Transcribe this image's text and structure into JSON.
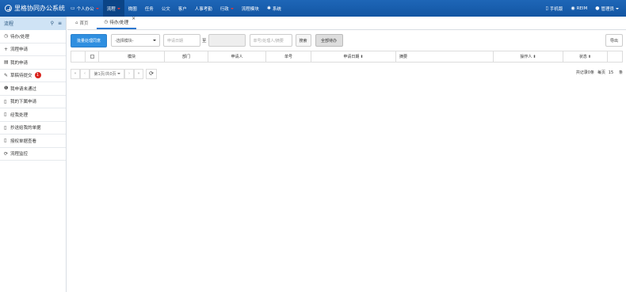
{
  "header": {
    "title": "里格协同办公系统",
    "nav": [
      {
        "label": "个人办公",
        "icon": "monitor-icon",
        "caret": true
      },
      {
        "label": "流程",
        "caret": true,
        "active": true
      },
      {
        "label": "微圈"
      },
      {
        "label": "任务"
      },
      {
        "label": "公文"
      },
      {
        "label": "客户"
      },
      {
        "label": "人事考勤"
      },
      {
        "label": "行政",
        "caret": true
      },
      {
        "label": "流程模块"
      },
      {
        "label": "系统",
        "icon": "gear-icon"
      }
    ],
    "right": [
      {
        "label": "手机版",
        "icon": "mobile-icon"
      },
      {
        "label": "REIM",
        "icon": "chat-icon"
      },
      {
        "label": "管理员",
        "icon": "user-icon",
        "caret": true
      }
    ]
  },
  "sidebar": {
    "title": "流程",
    "items": [
      {
        "label": "待办/处理",
        "icon": "clock-icon",
        "glyph": "◷"
      },
      {
        "label": "流程申请",
        "icon": "plus-icon",
        "glyph": "+"
      },
      {
        "label": "我的申请",
        "icon": "list-icon",
        "glyph": "▤"
      },
      {
        "label": "草稿待提交",
        "icon": "edit-icon",
        "glyph": "✎",
        "badge": "1"
      },
      {
        "label": "我申请未通过",
        "icon": "info-icon",
        "glyph": "❶"
      },
      {
        "label": "我的下属申请",
        "icon": "bookmark-icon",
        "glyph": "▯"
      },
      {
        "label": "经我处理",
        "icon": "bookmark-icon",
        "glyph": "▯"
      },
      {
        "label": "抄送给我的单据",
        "icon": "bookmark-icon",
        "glyph": "▯"
      },
      {
        "label": "授权单据查看",
        "icon": "bookmark-icon",
        "glyph": "▯"
      },
      {
        "label": "流程监控",
        "icon": "refresh-icon",
        "glyph": "⟳"
      }
    ]
  },
  "tabs": [
    {
      "label": "首页",
      "icon": "home-icon",
      "glyph": "⌂"
    },
    {
      "label": "待办/处理",
      "icon": "clock-icon",
      "glyph": "◷",
      "active": true
    }
  ],
  "toolbar": {
    "batch_label": "批量处理同意",
    "module_select": "-选择模块-",
    "date_from_placeholder": "申请日期",
    "range_sep": "至",
    "keyword_placeholder": "单号/处理人/摘要",
    "search_label": "搜索",
    "all_label": "全部待办",
    "export_label": "导出"
  },
  "table": {
    "columns": [
      "模块",
      "部门",
      "申请人",
      "单号",
      "申请日期",
      "摘要",
      "操作人",
      "状态"
    ]
  },
  "pager": {
    "first": "«",
    "prev": "‹",
    "page_text": "第1页/共0页",
    "next": "›",
    "last": "»",
    "total_text": "共记录0条",
    "per_page_label": "每页",
    "per_page_value": "15",
    "unit": "条"
  }
}
